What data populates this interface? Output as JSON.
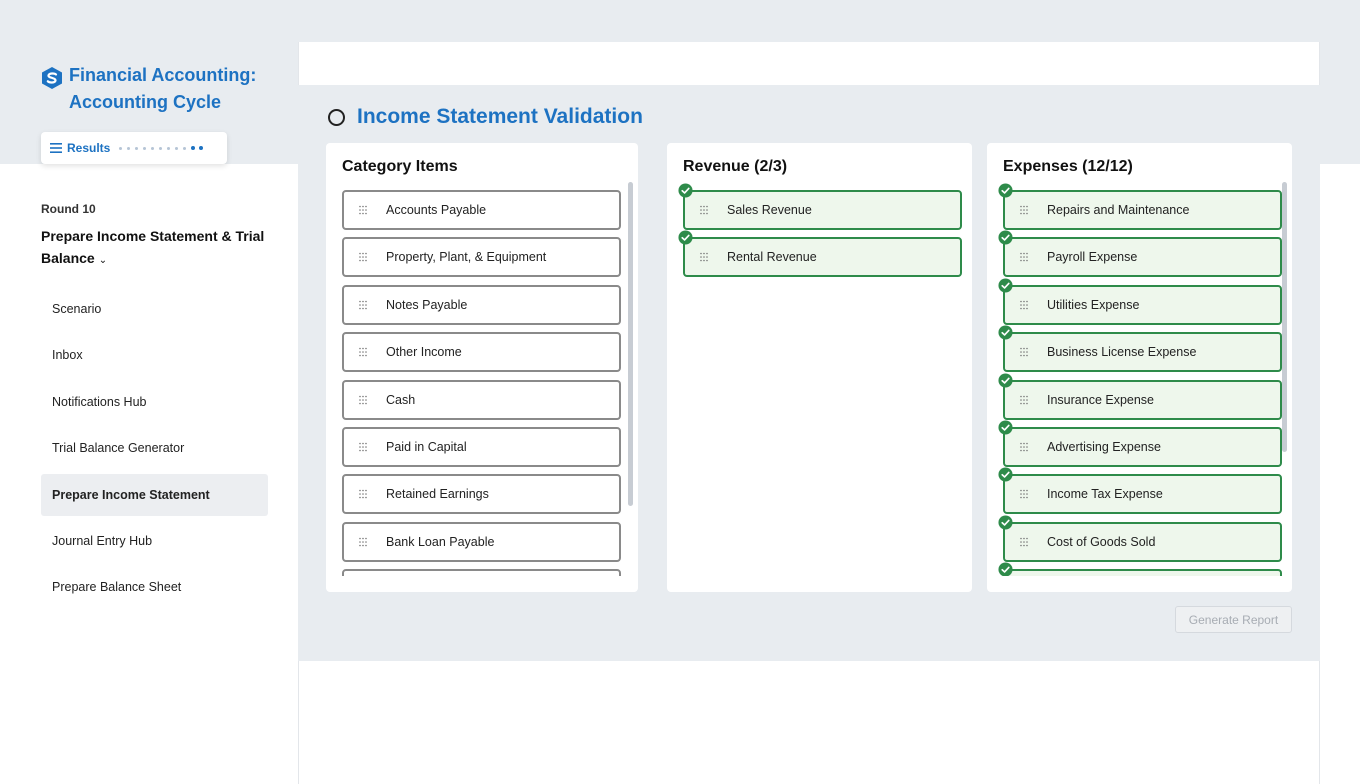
{
  "app": {
    "title_line1": "Financial Accounting:",
    "title_line2": "Accounting Cycle",
    "results_label": "Results",
    "accent": "#1d72c2"
  },
  "round": {
    "label": "Round 10",
    "title": "Prepare Income Statement & Trial Balance"
  },
  "nav": {
    "items": [
      {
        "label": "Scenario",
        "active": false
      },
      {
        "label": "Inbox",
        "active": false
      },
      {
        "label": "Notifications Hub",
        "active": false
      },
      {
        "label": "Trial Balance Generator",
        "active": false
      },
      {
        "label": "Prepare Income Statement",
        "active": true
      },
      {
        "label": "Journal Entry Hub",
        "active": false
      },
      {
        "label": "Prepare Balance Sheet",
        "active": false
      }
    ]
  },
  "workspace": {
    "title": "Income Statement Validation",
    "generate_label": "Generate Report"
  },
  "columns": {
    "category": {
      "title": "Category Items",
      "items": [
        "Accounts Payable",
        "Property, Plant, & Equipment",
        "Notes Payable",
        "Other Income",
        "Cash",
        "Paid in Capital",
        "Retained Earnings",
        "Bank Loan Payable"
      ]
    },
    "revenue": {
      "title": "Revenue (2/3)",
      "items": [
        "Sales Revenue",
        "Rental Revenue"
      ]
    },
    "expenses": {
      "title": "Expenses (12/12)",
      "items": [
        "Repairs and Maintenance",
        "Payroll Expense",
        "Utilities Expense",
        "Business License Expense",
        "Insurance Expense",
        "Advertising Expense",
        "Income Tax Expense",
        "Cost of Goods Sold"
      ]
    }
  },
  "colors": {
    "success": "#2e8b4a",
    "success_bg": "#eef7ec",
    "workspace_bg": "#e8ecf0"
  }
}
